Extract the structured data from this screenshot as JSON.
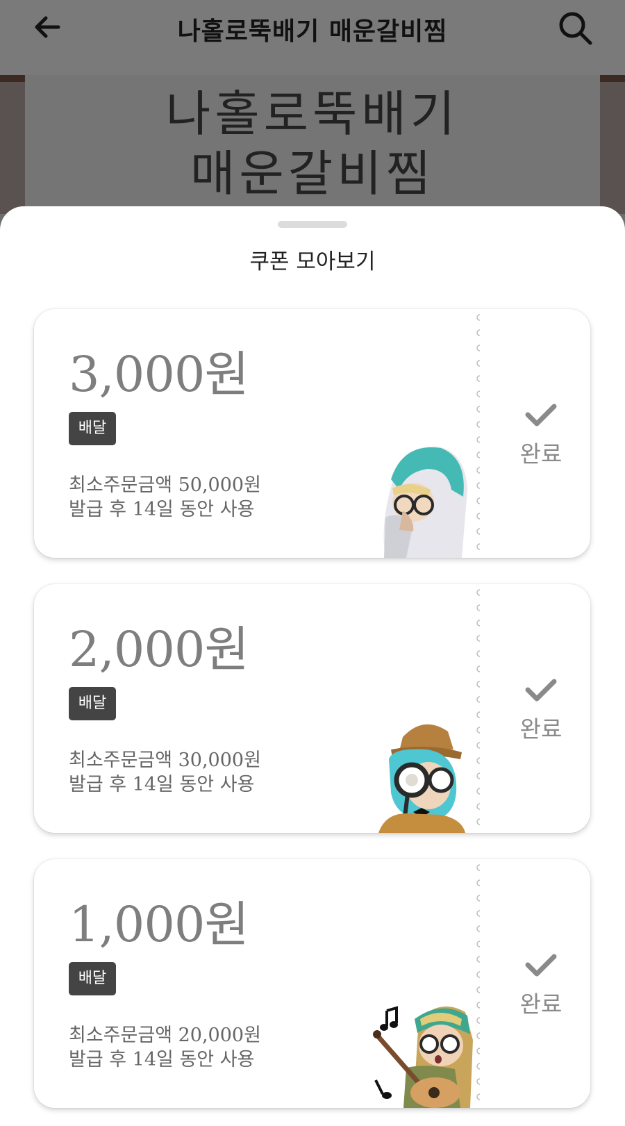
{
  "header": {
    "title": "나홀로뚝배기 매운갈비찜",
    "back_icon": "arrow-left-icon",
    "search_icon": "search-icon"
  },
  "banner": {
    "line1": "나홀로뚝배기",
    "line2": "매운갈비찜"
  },
  "sheet": {
    "title": "쿠폰 모아보기",
    "coupons": [
      {
        "amount": "3,000원",
        "tag": "배달",
        "min_order": "최소주문금액 50,000원",
        "validity": "발급 후 14일 동안 사용",
        "status": "완료"
      },
      {
        "amount": "2,000원",
        "tag": "배달",
        "min_order": "최소주문금액 30,000원",
        "validity": "발급 후 14일 동안 사용",
        "status": "완료"
      },
      {
        "amount": "1,000원",
        "tag": "배달",
        "min_order": "최소주문금액 20,000원",
        "validity": "발급 후 14일 동안 사용",
        "status": "완료"
      }
    ]
  },
  "colors": {
    "overlay": "#6e6e6e",
    "amount_text": "#7e7e7e",
    "tag_bg": "#444444",
    "status_text": "#8a8a8a"
  }
}
